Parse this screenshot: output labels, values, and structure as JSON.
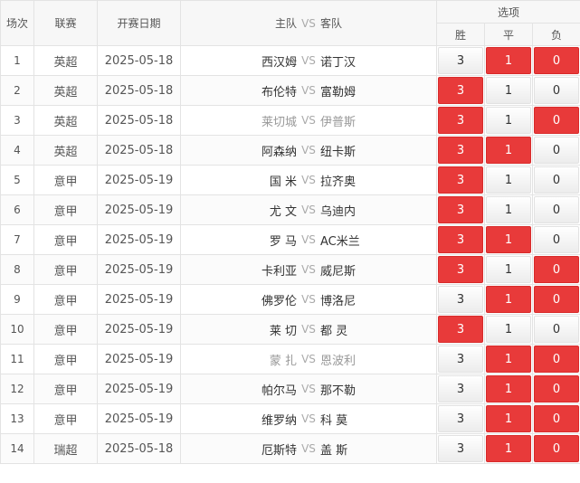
{
  "header": {
    "index": "场次",
    "league": "联赛",
    "date": "开赛日期",
    "home": "主队",
    "vs": "VS",
    "away": "客队",
    "options": "选项",
    "win": "胜",
    "draw": "平",
    "lose": "负"
  },
  "rows": [
    {
      "idx": "1",
      "league": "英超",
      "date": "2025-05-18",
      "home": "西汉姆",
      "vs": "VS",
      "away": "诺丁汉",
      "win": "3",
      "draw": "1",
      "lose": "0",
      "win_sel": false,
      "draw_sel": true,
      "lose_sel": true,
      "dim": false
    },
    {
      "idx": "2",
      "league": "英超",
      "date": "2025-05-18",
      "home": "布伦特",
      "vs": "VS",
      "away": "富勒姆",
      "win": "3",
      "draw": "1",
      "lose": "0",
      "win_sel": true,
      "draw_sel": false,
      "lose_sel": false,
      "dim": false
    },
    {
      "idx": "3",
      "league": "英超",
      "date": "2025-05-18",
      "home": "莱切城",
      "vs": "VS",
      "away": "伊普斯",
      "win": "3",
      "draw": "1",
      "lose": "0",
      "win_sel": true,
      "draw_sel": false,
      "lose_sel": true,
      "dim": true
    },
    {
      "idx": "4",
      "league": "英超",
      "date": "2025-05-18",
      "home": "阿森纳",
      "vs": "VS",
      "away": "纽卡斯",
      "win": "3",
      "draw": "1",
      "lose": "0",
      "win_sel": true,
      "draw_sel": true,
      "lose_sel": false,
      "dim": false
    },
    {
      "idx": "5",
      "league": "意甲",
      "date": "2025-05-19",
      "home": "国 米",
      "vs": "VS",
      "away": "拉齐奥",
      "win": "3",
      "draw": "1",
      "lose": "0",
      "win_sel": true,
      "draw_sel": false,
      "lose_sel": false,
      "dim": false
    },
    {
      "idx": "6",
      "league": "意甲",
      "date": "2025-05-19",
      "home": "尤 文",
      "vs": "VS",
      "away": "乌迪内",
      "win": "3",
      "draw": "1",
      "lose": "0",
      "win_sel": true,
      "draw_sel": false,
      "lose_sel": false,
      "dim": false
    },
    {
      "idx": "7",
      "league": "意甲",
      "date": "2025-05-19",
      "home": "罗 马",
      "vs": "VS",
      "away": "AC米兰",
      "win": "3",
      "draw": "1",
      "lose": "0",
      "win_sel": true,
      "draw_sel": true,
      "lose_sel": false,
      "dim": false
    },
    {
      "idx": "8",
      "league": "意甲",
      "date": "2025-05-19",
      "home": "卡利亚",
      "vs": "VS",
      "away": "威尼斯",
      "win": "3",
      "draw": "1",
      "lose": "0",
      "win_sel": true,
      "draw_sel": false,
      "lose_sel": true,
      "dim": false
    },
    {
      "idx": "9",
      "league": "意甲",
      "date": "2025-05-19",
      "home": "佛罗伦",
      "vs": "VS",
      "away": "博洛尼",
      "win": "3",
      "draw": "1",
      "lose": "0",
      "win_sel": false,
      "draw_sel": true,
      "lose_sel": true,
      "dim": false
    },
    {
      "idx": "10",
      "league": "意甲",
      "date": "2025-05-19",
      "home": "莱 切",
      "vs": "VS",
      "away": "都 灵",
      "win": "3",
      "draw": "1",
      "lose": "0",
      "win_sel": true,
      "draw_sel": false,
      "lose_sel": false,
      "dim": false
    },
    {
      "idx": "11",
      "league": "意甲",
      "date": "2025-05-19",
      "home": "蒙 扎",
      "vs": "VS",
      "away": "恩波利",
      "win": "3",
      "draw": "1",
      "lose": "0",
      "win_sel": false,
      "draw_sel": true,
      "lose_sel": true,
      "dim": true
    },
    {
      "idx": "12",
      "league": "意甲",
      "date": "2025-05-19",
      "home": "帕尔马",
      "vs": "VS",
      "away": "那不勒",
      "win": "3",
      "draw": "1",
      "lose": "0",
      "win_sel": false,
      "draw_sel": true,
      "lose_sel": true,
      "dim": false
    },
    {
      "idx": "13",
      "league": "意甲",
      "date": "2025-05-19",
      "home": "维罗纳",
      "vs": "VS",
      "away": "科 莫",
      "win": "3",
      "draw": "1",
      "lose": "0",
      "win_sel": false,
      "draw_sel": true,
      "lose_sel": true,
      "dim": false
    },
    {
      "idx": "14",
      "league": "瑞超",
      "date": "2025-05-18",
      "home": "厄斯特",
      "vs": "VS",
      "away": "盖 斯",
      "win": "3",
      "draw": "1",
      "lose": "0",
      "win_sel": false,
      "draw_sel": true,
      "lose_sel": true,
      "dim": false
    }
  ],
  "colors": {
    "selected": "#e83a3a",
    "header_bg": "#f7f7f7",
    "dim_team": "#999999"
  }
}
